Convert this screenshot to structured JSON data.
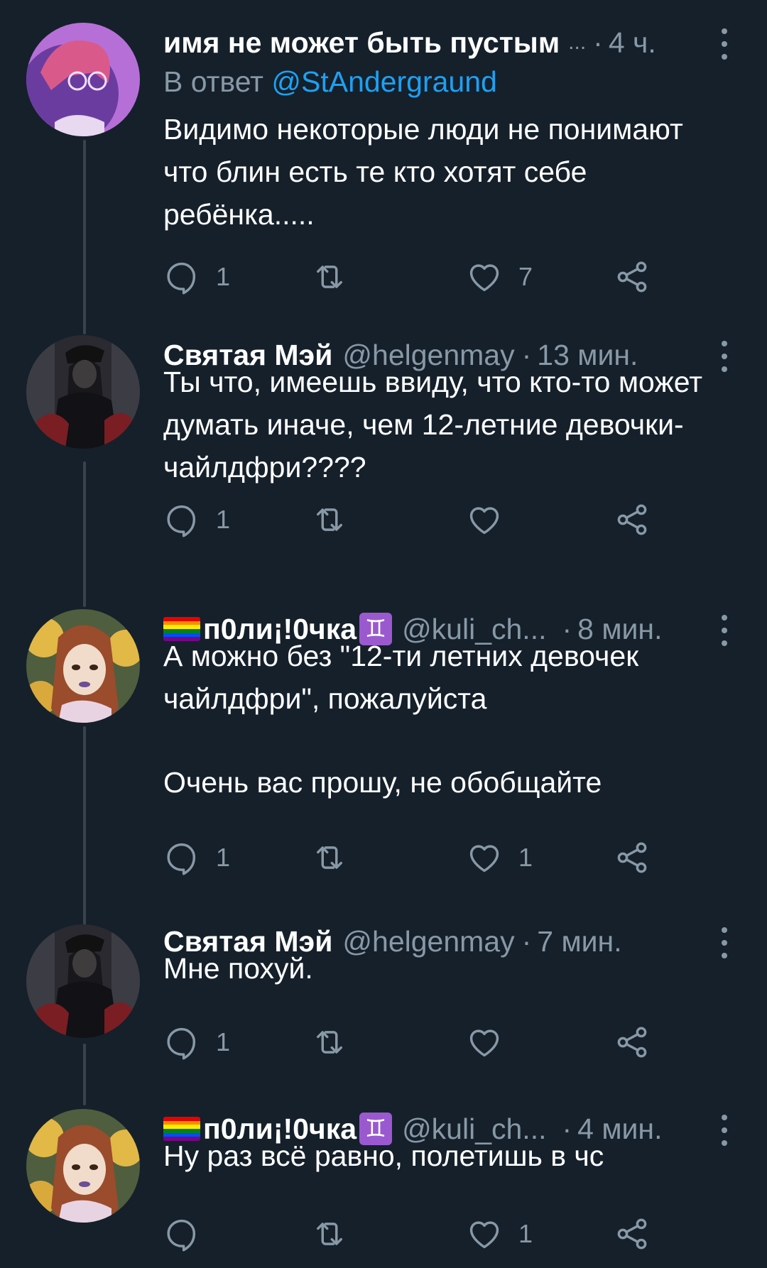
{
  "theme": {
    "background": "#15202b",
    "text": "#ffffff",
    "muted": "#8899a6",
    "link": "#1da1f2",
    "thread_line": "#38444d"
  },
  "tweets": [
    {
      "name": "имя не может быть пустым",
      "name_ellipsis": "...",
      "handle": "",
      "dot": "·",
      "time": "4 ч.",
      "reply_prefix": "В ответ",
      "reply_mention": "@StAndergraund",
      "text": "Видимо некоторые люди не понимают что блин есть те кто хотят себе ребёнка.....",
      "replies": "1",
      "retweets": "",
      "likes": "7"
    },
    {
      "name": "Святая Мэй",
      "handle": "@helgenmay",
      "dot": "·",
      "time": "13 мин.",
      "text": "Ты что, имеешь ввиду, что кто-то может думать иначе, чем 12-летние девочки-чайлдфри????",
      "replies": "1",
      "retweets": "",
      "likes": ""
    },
    {
      "name": "п0ли¡!0чка",
      "handle": "@kuli_ch...",
      "dot": "·",
      "time": "8 мин.",
      "gemini_glyph": "♊",
      "text_1": "А можно без \"12-ти летних девочек чайлдфри\", пожалуйста",
      "text_2": "Очень вас прошу, не обобщайте",
      "replies": "1",
      "retweets": "",
      "likes": "1"
    },
    {
      "name": "Святая Мэй",
      "handle": "@helgenmay",
      "dot": "·",
      "time": "7 мин.",
      "text": "Мне похуй.",
      "replies": "1",
      "retweets": "",
      "likes": ""
    },
    {
      "name": "п0ли¡!0чка",
      "handle": "@kuli_ch...",
      "dot": "·",
      "time": "4 мин.",
      "gemini_glyph": "♊",
      "text": "Ну раз всё равно, полетишь в чс",
      "replies": "",
      "retweets": "",
      "likes": "1"
    }
  ]
}
